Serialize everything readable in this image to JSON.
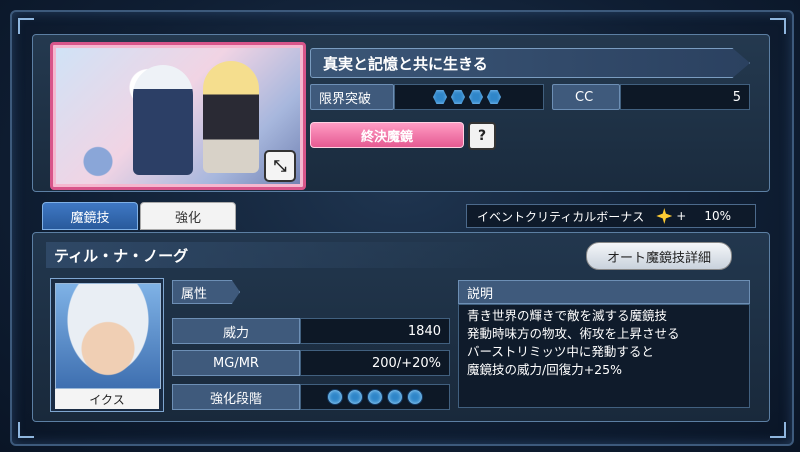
{
  "card": {
    "title": "真実と記憶と共に生きる",
    "limit_break_label": "限界突破",
    "limit_break_level": 4,
    "cc_label": "CC",
    "cc_value": "5",
    "final_mirror_label": "終決魔鏡",
    "help_symbol": "?",
    "expand_symbol": "⤡"
  },
  "tabs": [
    {
      "label": "魔鏡技"
    },
    {
      "label": "強化"
    }
  ],
  "event_bonus": {
    "label": "イベントクリティカルボーナス",
    "plus": "+",
    "value": "10%"
  },
  "skill": {
    "name": "ティル・ナ・ノーグ",
    "auto_detail_label": "オート魔鏡技詳細",
    "character_name": "イクス",
    "attribute_label": "属性",
    "stats": [
      {
        "label": "威力",
        "value": "1840"
      },
      {
        "label": "MG/MR",
        "value": "200/+20%"
      },
      {
        "label": "強化段階",
        "value": ""
      }
    ],
    "enhance_level": 5,
    "description_label": "説明",
    "description_lines": [
      "青き世界の輝きで敵を滅する魔鏡技",
      "発動時味方の物攻、術攻を上昇させる",
      "バーストリミッツ中に発動すると",
      "魔鏡技の威力/回復力+25%"
    ]
  },
  "colors": {
    "accent_pink": "#e55a92",
    "accent_blue": "#2f86c9",
    "panel_border": "#5c7fa3"
  }
}
